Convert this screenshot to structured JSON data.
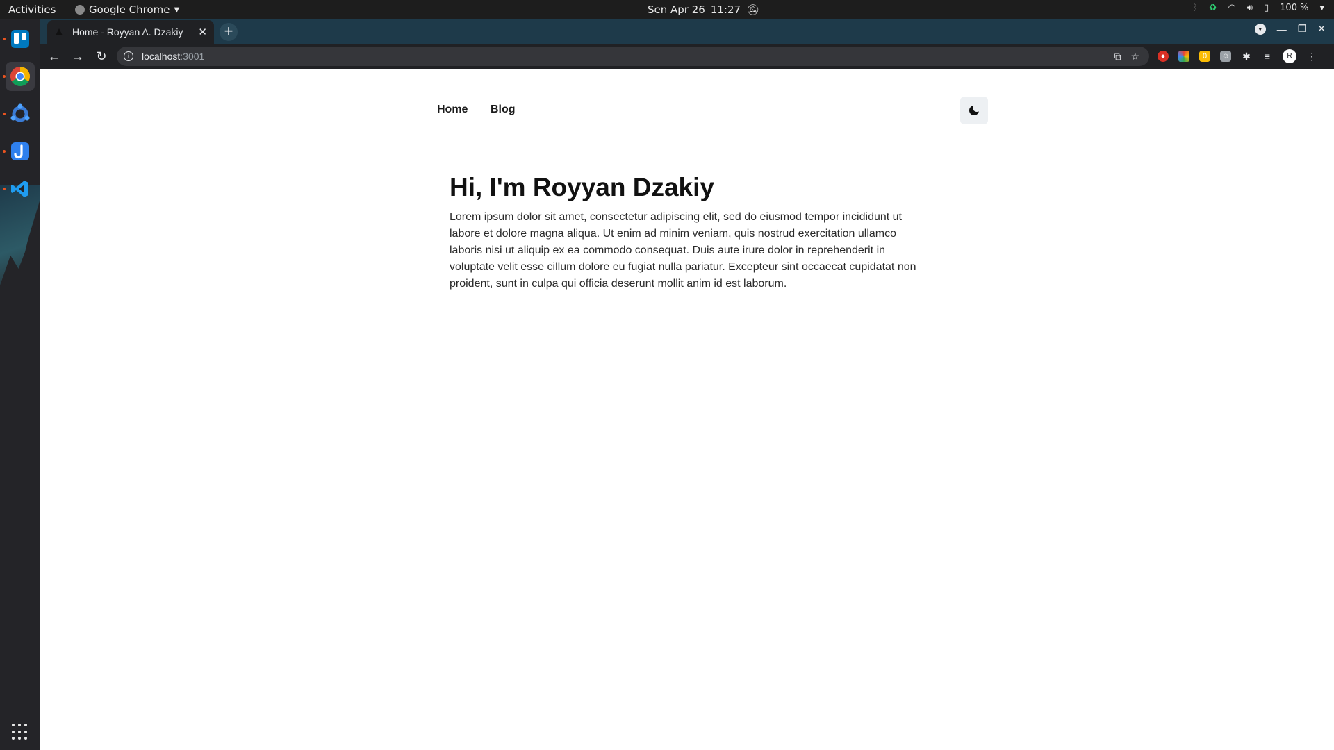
{
  "topbar": {
    "activities": "Activities",
    "app_name": "Google Chrome",
    "date": "Sen Apr 26",
    "time": "11:27",
    "battery": "100 %"
  },
  "dock": {
    "items": [
      {
        "name": "Trello",
        "icon": "trello-icon",
        "color": "#0079bf"
      },
      {
        "name": "Google Chrome",
        "icon": "chrome-icon",
        "color": "#4285f4"
      },
      {
        "name": "Kubuntu/Studio",
        "icon": "app-hex-icon",
        "color": "#3a7bd5"
      },
      {
        "name": "Postman/DJ",
        "icon": "j-app-icon",
        "color": "#2f80ed"
      },
      {
        "name": "Visual Studio Code",
        "icon": "vscode-icon",
        "color": "#1f9cf0"
      }
    ]
  },
  "browser": {
    "tab_title": "Home - Royyan A. Dzakiy",
    "url_host": "localhost",
    "url_port": ":3001",
    "avatar_letter": "R",
    "ext_badge": "0"
  },
  "site": {
    "nav": {
      "home": "Home",
      "blog": "Blog"
    },
    "heading": "Hi, I'm Royyan Dzakiy",
    "intro": "Lorem ipsum dolor sit amet, consectetur adipiscing elit, sed do eiusmod tempor incididunt ut labore et dolore magna aliqua. Ut enim ad minim veniam, quis nostrud exercitation ullamco laboris nisi ut aliquip ex ea commodo consequat. Duis aute irure dolor in reprehenderit in voluptate velit esse cillum dolore eu fugiat nulla pariatur. Excepteur sint occaecat cupidatat non proident, sunt in culpa qui officia deserunt mollit anim id est laborum."
  },
  "colors": {
    "tabstrip": "#1e3a4a",
    "toolbar": "#202124",
    "toggle_bg": "#edf0f3"
  }
}
